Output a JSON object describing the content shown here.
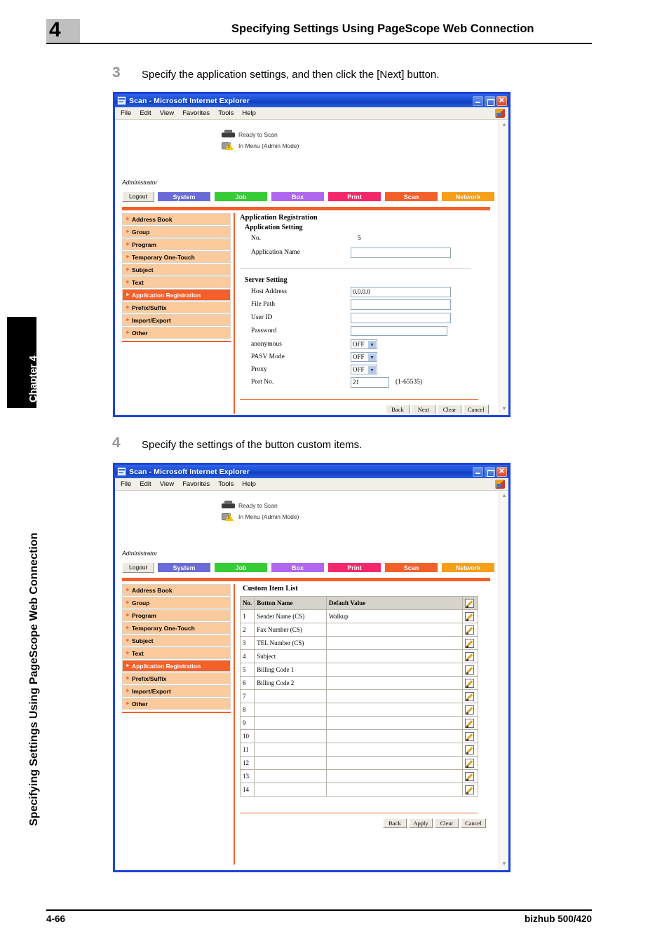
{
  "page_header": {
    "chapter_number": "4",
    "title": "Specifying Settings Using PageScope Web Connection"
  },
  "side_margin": {
    "chapter_tab": "Chapter 4",
    "running_head": "Specifying Settings Using PageScope Web Connection"
  },
  "steps": [
    {
      "number": "3",
      "text": "Specify the application settings, and then click the [Next] button."
    },
    {
      "number": "4",
      "text": "Specify the settings of the button custom items."
    }
  ],
  "browser": {
    "title": "Scan - Microsoft Internet Explorer",
    "menu_items": [
      "File",
      "Edit",
      "View",
      "Favorites",
      "Tools",
      "Help"
    ],
    "window_buttons": {
      "minimize": "minimize-icon",
      "maximize": "maximize-icon",
      "close": "✕"
    }
  },
  "webapp": {
    "status": [
      {
        "icon": "printer-icon",
        "text": "Ready to Scan"
      },
      {
        "icon": "printer-warning-icon",
        "text": "In Menu (Admin Mode)"
      }
    ],
    "administrator_label": "Administrator",
    "logout_label": "Logout",
    "nav_tabs": [
      {
        "label": "System",
        "color": "#6b6bd8"
      },
      {
        "label": "Job",
        "color": "#35cc35"
      },
      {
        "label": "Box",
        "color": "#b066ee"
      },
      {
        "label": "Print",
        "color": "#f5276b"
      },
      {
        "label": "Scan",
        "color": "#f4602a"
      },
      {
        "label": "Network",
        "color": "#f79f18"
      }
    ],
    "sidebar_items": [
      {
        "label": "Address Book",
        "active": false
      },
      {
        "label": "Group",
        "active": false
      },
      {
        "label": "Program",
        "active": false
      },
      {
        "label": "Temporary One-Touch",
        "active": false
      },
      {
        "label": "Subject",
        "active": false
      },
      {
        "label": "Text",
        "active": false
      },
      {
        "label": "Application Registration",
        "active": true
      },
      {
        "label": "Prefix/Suffix",
        "active": false
      },
      {
        "label": "Import/Export",
        "active": false
      },
      {
        "label": "Other",
        "active": false
      }
    ],
    "accent_color": "#f4602a"
  },
  "screen_app_reg": {
    "heading": "Application Registration",
    "section_application": {
      "title": "Application Setting",
      "no_label": "No.",
      "no_value": "5",
      "app_name_label": "Application Name",
      "app_name_value": ""
    },
    "section_server": {
      "title": "Server Setting",
      "fields": [
        {
          "label": "Host Address",
          "value": "0.0.0.0",
          "type": "text"
        },
        {
          "label": "File Path",
          "value": "",
          "type": "text"
        },
        {
          "label": "User ID",
          "value": "",
          "type": "text"
        },
        {
          "label": "Password",
          "value": "",
          "type": "text"
        },
        {
          "label": "anonymous",
          "value": "OFF",
          "type": "select"
        },
        {
          "label": "PASV Mode",
          "value": "OFF",
          "type": "select"
        },
        {
          "label": "Proxy",
          "value": "OFF",
          "type": "select"
        },
        {
          "label": "Port No.",
          "value": "21",
          "type": "text",
          "hint": "(1-65535)"
        }
      ]
    },
    "buttons": [
      "Back",
      "Next",
      "Clear",
      "Cancel"
    ]
  },
  "screen_custom_items": {
    "heading": "Custom Item List",
    "columns": [
      "No.",
      "Button Name",
      "Default Value",
      ""
    ],
    "rows": [
      {
        "no": "1",
        "name": "Sender Name (CS)",
        "value": "Walkup"
      },
      {
        "no": "2",
        "name": "Fax Number (CS)",
        "value": ""
      },
      {
        "no": "3",
        "name": "TEL Number (CS)",
        "value": ""
      },
      {
        "no": "4",
        "name": "Subject",
        "value": ""
      },
      {
        "no": "5",
        "name": "Billing Code 1",
        "value": ""
      },
      {
        "no": "6",
        "name": "Billing Code 2",
        "value": ""
      },
      {
        "no": "7",
        "name": "",
        "value": ""
      },
      {
        "no": "8",
        "name": "",
        "value": ""
      },
      {
        "no": "9",
        "name": "",
        "value": ""
      },
      {
        "no": "10",
        "name": "",
        "value": ""
      },
      {
        "no": "11",
        "name": "",
        "value": ""
      },
      {
        "no": "12",
        "name": "",
        "value": ""
      },
      {
        "no": "13",
        "name": "",
        "value": ""
      },
      {
        "no": "14",
        "name": "",
        "value": ""
      }
    ],
    "buttons": [
      "Back",
      "Apply",
      "Clear",
      "Cancel"
    ],
    "edit_icon": "pencil-icon"
  },
  "footer": {
    "page_number": "4-66",
    "product": "bizhub 500/420"
  }
}
